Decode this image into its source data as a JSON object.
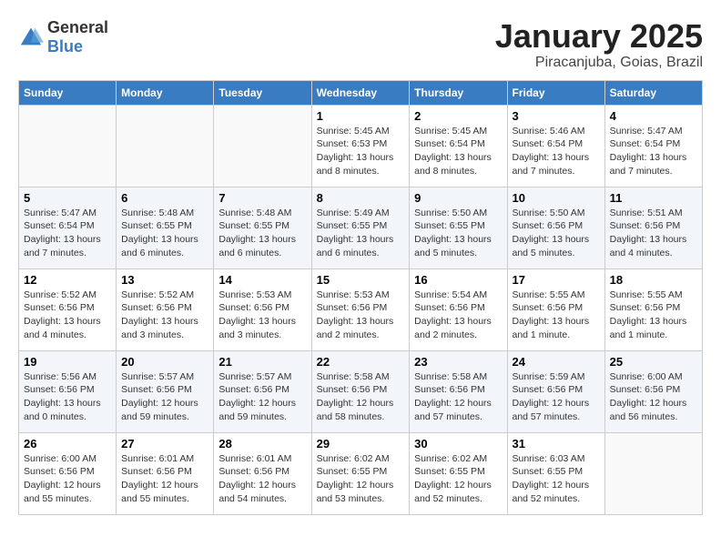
{
  "header": {
    "logo": {
      "general": "General",
      "blue": "Blue"
    },
    "title": "January 2025",
    "subtitle": "Piracanjuba, Goias, Brazil"
  },
  "days_of_week": [
    "Sunday",
    "Monday",
    "Tuesday",
    "Wednesday",
    "Thursday",
    "Friday",
    "Saturday"
  ],
  "weeks": [
    [
      {
        "day": "",
        "detail": ""
      },
      {
        "day": "",
        "detail": ""
      },
      {
        "day": "",
        "detail": ""
      },
      {
        "day": "1",
        "detail": "Sunrise: 5:45 AM\nSunset: 6:53 PM\nDaylight: 13 hours and 8 minutes."
      },
      {
        "day": "2",
        "detail": "Sunrise: 5:45 AM\nSunset: 6:54 PM\nDaylight: 13 hours and 8 minutes."
      },
      {
        "day": "3",
        "detail": "Sunrise: 5:46 AM\nSunset: 6:54 PM\nDaylight: 13 hours and 7 minutes."
      },
      {
        "day": "4",
        "detail": "Sunrise: 5:47 AM\nSunset: 6:54 PM\nDaylight: 13 hours and 7 minutes."
      }
    ],
    [
      {
        "day": "5",
        "detail": "Sunrise: 5:47 AM\nSunset: 6:54 PM\nDaylight: 13 hours and 7 minutes."
      },
      {
        "day": "6",
        "detail": "Sunrise: 5:48 AM\nSunset: 6:55 PM\nDaylight: 13 hours and 6 minutes."
      },
      {
        "day": "7",
        "detail": "Sunrise: 5:48 AM\nSunset: 6:55 PM\nDaylight: 13 hours and 6 minutes."
      },
      {
        "day": "8",
        "detail": "Sunrise: 5:49 AM\nSunset: 6:55 PM\nDaylight: 13 hours and 6 minutes."
      },
      {
        "day": "9",
        "detail": "Sunrise: 5:50 AM\nSunset: 6:55 PM\nDaylight: 13 hours and 5 minutes."
      },
      {
        "day": "10",
        "detail": "Sunrise: 5:50 AM\nSunset: 6:56 PM\nDaylight: 13 hours and 5 minutes."
      },
      {
        "day": "11",
        "detail": "Sunrise: 5:51 AM\nSunset: 6:56 PM\nDaylight: 13 hours and 4 minutes."
      }
    ],
    [
      {
        "day": "12",
        "detail": "Sunrise: 5:52 AM\nSunset: 6:56 PM\nDaylight: 13 hours and 4 minutes."
      },
      {
        "day": "13",
        "detail": "Sunrise: 5:52 AM\nSunset: 6:56 PM\nDaylight: 13 hours and 3 minutes."
      },
      {
        "day": "14",
        "detail": "Sunrise: 5:53 AM\nSunset: 6:56 PM\nDaylight: 13 hours and 3 minutes."
      },
      {
        "day": "15",
        "detail": "Sunrise: 5:53 AM\nSunset: 6:56 PM\nDaylight: 13 hours and 2 minutes."
      },
      {
        "day": "16",
        "detail": "Sunrise: 5:54 AM\nSunset: 6:56 PM\nDaylight: 13 hours and 2 minutes."
      },
      {
        "day": "17",
        "detail": "Sunrise: 5:55 AM\nSunset: 6:56 PM\nDaylight: 13 hours and 1 minute."
      },
      {
        "day": "18",
        "detail": "Sunrise: 5:55 AM\nSunset: 6:56 PM\nDaylight: 13 hours and 1 minute."
      }
    ],
    [
      {
        "day": "19",
        "detail": "Sunrise: 5:56 AM\nSunset: 6:56 PM\nDaylight: 13 hours and 0 minutes."
      },
      {
        "day": "20",
        "detail": "Sunrise: 5:57 AM\nSunset: 6:56 PM\nDaylight: 12 hours and 59 minutes."
      },
      {
        "day": "21",
        "detail": "Sunrise: 5:57 AM\nSunset: 6:56 PM\nDaylight: 12 hours and 59 minutes."
      },
      {
        "day": "22",
        "detail": "Sunrise: 5:58 AM\nSunset: 6:56 PM\nDaylight: 12 hours and 58 minutes."
      },
      {
        "day": "23",
        "detail": "Sunrise: 5:58 AM\nSunset: 6:56 PM\nDaylight: 12 hours and 57 minutes."
      },
      {
        "day": "24",
        "detail": "Sunrise: 5:59 AM\nSunset: 6:56 PM\nDaylight: 12 hours and 57 minutes."
      },
      {
        "day": "25",
        "detail": "Sunrise: 6:00 AM\nSunset: 6:56 PM\nDaylight: 12 hours and 56 minutes."
      }
    ],
    [
      {
        "day": "26",
        "detail": "Sunrise: 6:00 AM\nSunset: 6:56 PM\nDaylight: 12 hours and 55 minutes."
      },
      {
        "day": "27",
        "detail": "Sunrise: 6:01 AM\nSunset: 6:56 PM\nDaylight: 12 hours and 55 minutes."
      },
      {
        "day": "28",
        "detail": "Sunrise: 6:01 AM\nSunset: 6:56 PM\nDaylight: 12 hours and 54 minutes."
      },
      {
        "day": "29",
        "detail": "Sunrise: 6:02 AM\nSunset: 6:55 PM\nDaylight: 12 hours and 53 minutes."
      },
      {
        "day": "30",
        "detail": "Sunrise: 6:02 AM\nSunset: 6:55 PM\nDaylight: 12 hours and 52 minutes."
      },
      {
        "day": "31",
        "detail": "Sunrise: 6:03 AM\nSunset: 6:55 PM\nDaylight: 12 hours and 52 minutes."
      },
      {
        "day": "",
        "detail": ""
      }
    ]
  ]
}
